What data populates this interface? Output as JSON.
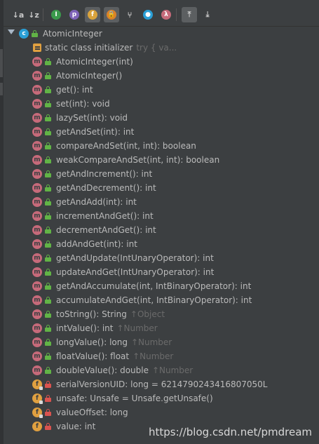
{
  "toolbar": {
    "buttons": [
      {
        "name": "sort-by-type-icon",
        "glyph": "↓a",
        "active": false
      },
      {
        "name": "sort-alphabetically-icon",
        "glyph": "↓z",
        "active": false
      },
      {
        "name": "show-inherited-icon",
        "glyph": "I",
        "active": false
      },
      {
        "name": "show-properties-icon",
        "glyph": "p",
        "active": false
      },
      {
        "name": "show-fields-icon",
        "glyph": "f",
        "active": true
      },
      {
        "name": "show-non-public-icon",
        "glyph": "🔒",
        "active": true
      },
      {
        "name": "show-anonymous-classes-icon",
        "glyph": "⑂",
        "active": false
      },
      {
        "name": "show-lambdas-icon",
        "glyph": "●",
        "active": false
      },
      {
        "name": "show-lambda-icon",
        "glyph": "λ",
        "active": false
      },
      {
        "name": "autoscroll-to-source-icon",
        "glyph": "⤒",
        "active": true
      },
      {
        "name": "autoscroll-from-source-icon",
        "glyph": "⤓",
        "active": false
      }
    ]
  },
  "tree": {
    "root": {
      "label": "AtomicInteger",
      "icon": "class"
    },
    "items": [
      {
        "kind": "init",
        "vis": "none",
        "label": "static class initializer",
        "suffix": "try {            va..."
      },
      {
        "kind": "m",
        "vis": "pub",
        "label": "AtomicInteger(int)",
        "suffix": ""
      },
      {
        "kind": "m",
        "vis": "pub",
        "label": "AtomicInteger()",
        "suffix": ""
      },
      {
        "kind": "m",
        "vis": "pub",
        "label": "get(): int",
        "suffix": ""
      },
      {
        "kind": "m",
        "vis": "pub",
        "label": "set(int): void",
        "suffix": ""
      },
      {
        "kind": "m",
        "vis": "pub",
        "label": "lazySet(int): void",
        "suffix": ""
      },
      {
        "kind": "m",
        "vis": "pub",
        "label": "getAndSet(int): int",
        "suffix": ""
      },
      {
        "kind": "m",
        "vis": "pub",
        "label": "compareAndSet(int, int): boolean",
        "suffix": ""
      },
      {
        "kind": "m",
        "vis": "pub",
        "label": "weakCompareAndSet(int, int): boolean",
        "suffix": ""
      },
      {
        "kind": "m",
        "vis": "pub",
        "label": "getAndIncrement(): int",
        "suffix": ""
      },
      {
        "kind": "m",
        "vis": "pub",
        "label": "getAndDecrement(): int",
        "suffix": ""
      },
      {
        "kind": "m",
        "vis": "pub",
        "label": "getAndAdd(int): int",
        "suffix": ""
      },
      {
        "kind": "m",
        "vis": "pub",
        "label": "incrementAndGet(): int",
        "suffix": ""
      },
      {
        "kind": "m",
        "vis": "pub",
        "label": "decrementAndGet(): int",
        "suffix": ""
      },
      {
        "kind": "m",
        "vis": "pub",
        "label": "addAndGet(int): int",
        "suffix": ""
      },
      {
        "kind": "m",
        "vis": "pub",
        "label": "getAndUpdate(IntUnaryOperator): int",
        "suffix": ""
      },
      {
        "kind": "m",
        "vis": "pub",
        "label": "updateAndGet(IntUnaryOperator): int",
        "suffix": ""
      },
      {
        "kind": "m",
        "vis": "pub",
        "label": "getAndAccumulate(int, IntBinaryOperator): int",
        "suffix": ""
      },
      {
        "kind": "m",
        "vis": "pub",
        "label": "accumulateAndGet(int, IntBinaryOperator): int",
        "suffix": ""
      },
      {
        "kind": "m",
        "vis": "pub",
        "label": "toString(): String",
        "suffix": "↑Object"
      },
      {
        "kind": "m",
        "vis": "pub",
        "label": "intValue(): int",
        "suffix": "↑Number"
      },
      {
        "kind": "m",
        "vis": "pub",
        "label": "longValue(): long",
        "suffix": "↑Number"
      },
      {
        "kind": "m",
        "vis": "pub",
        "label": "floatValue(): float",
        "suffix": "↑Number"
      },
      {
        "kind": "m",
        "vis": "pub",
        "label": "doubleValue(): double",
        "suffix": "↑Number"
      },
      {
        "kind": "f",
        "vis": "priv",
        "label": "serialVersionUID: long = 6214790243416807050L",
        "suffix": "",
        "pinned": true
      },
      {
        "kind": "f",
        "vis": "priv",
        "label": "unsafe: Unsafe = Unsafe.getUnsafe()",
        "suffix": "",
        "pinned": true
      },
      {
        "kind": "f",
        "vis": "priv",
        "label": "valueOffset: long",
        "suffix": "",
        "pinned": true
      },
      {
        "kind": "f",
        "vis": "priv",
        "label": "value: int",
        "suffix": ""
      }
    ]
  },
  "watermark": "https://blog.csdn.net/pmdream"
}
